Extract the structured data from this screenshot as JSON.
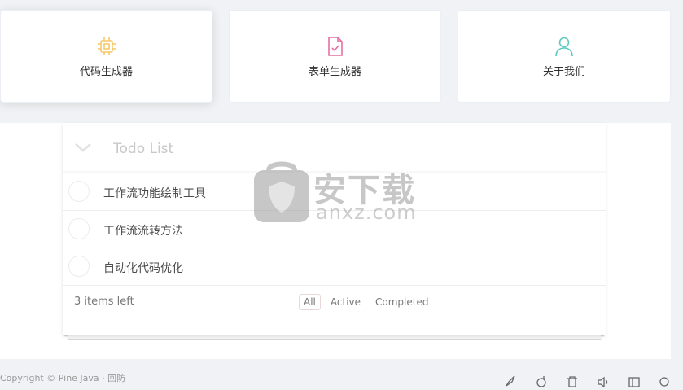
{
  "cards": [
    {
      "label": "代码生成器",
      "icon": "chip-icon",
      "color": "#f5c96a"
    },
    {
      "label": "表单生成器",
      "icon": "form-check-icon",
      "color": "#e66fa4"
    },
    {
      "label": "关于我们",
      "icon": "user-icon",
      "color": "#5cc9c0"
    }
  ],
  "todo": {
    "placeholder": "Todo List",
    "items": [
      {
        "text": "工作流功能绘制工具"
      },
      {
        "text": "工作流流转方法"
      },
      {
        "text": "自动化代码优化"
      }
    ],
    "count_label": "3 items left",
    "filters": [
      "All",
      "Active",
      "Completed"
    ],
    "selected_filter": "All"
  },
  "watermark": {
    "title": "安下载",
    "domain": "anxz.com"
  },
  "footer_text": "Copyright © Pine Java · 回防"
}
